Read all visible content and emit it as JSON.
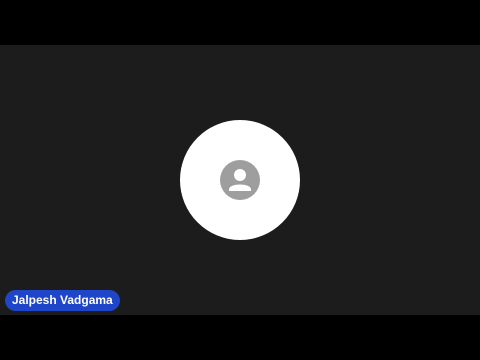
{
  "participant": {
    "name": "Jalpesh Vadgama",
    "avatar_icon": "person-icon"
  },
  "colors": {
    "tile_background": "#1c1c1c",
    "avatar_background": "#ffffff",
    "avatar_icon": "#9e9e9e",
    "name_badge": "#1f45c8",
    "name_text": "#ffffff"
  }
}
